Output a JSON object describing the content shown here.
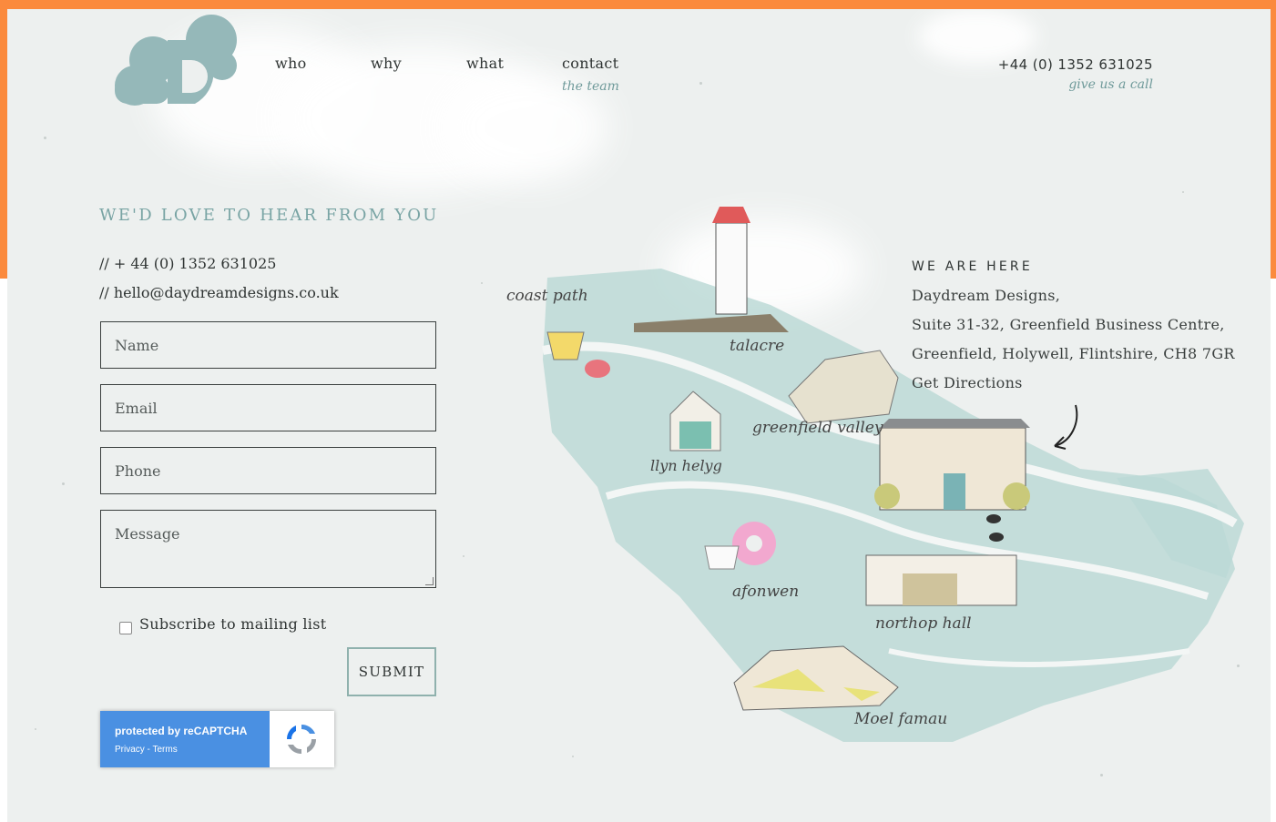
{
  "brand": {
    "logo_icon": "cloud-d-logo-icon"
  },
  "nav": {
    "items": [
      {
        "label": "who"
      },
      {
        "label": "why"
      },
      {
        "label": "what"
      },
      {
        "label": "contact",
        "sub": "the team"
      }
    ],
    "phone": "+44 (0) 1352 631025",
    "phone_sub": "give us a call"
  },
  "contact": {
    "heading": "WE'D LOVE TO HEAR FROM YOU",
    "phone_line": "// + 44 (0) 1352 631025",
    "email_line": "// hello@daydreamdesigns.co.uk"
  },
  "form": {
    "name_placeholder": "Name",
    "email_placeholder": "Email",
    "phone_placeholder": "Phone",
    "message_placeholder": "Message",
    "subscribe_label": "Subscribe to mailing list",
    "subscribe_checked": false,
    "submit_label": "SUBMIT"
  },
  "recaptcha": {
    "title": "protected by reCAPTCHA",
    "links": "Privacy - Terms",
    "icon": "recaptcha-icon"
  },
  "map": {
    "labels": [
      "coast path",
      "talacre",
      "greenfield valley",
      "llyn helyg",
      "afonwen",
      "northop hall",
      "Moel famau"
    ]
  },
  "location": {
    "title": "WE ARE HERE",
    "company": "Daydream Designs,",
    "line1": "Suite 31-32, Greenfield Business Centre,",
    "line2": "Greenfield, Holywell, Flintshire, CH8 7GR",
    "directions": "Get Directions"
  },
  "colors": {
    "accent_orange": "#fb8a3d",
    "teal": "#79a4a4",
    "map_water": "#bcd9d6",
    "background": "#edf0ef"
  }
}
